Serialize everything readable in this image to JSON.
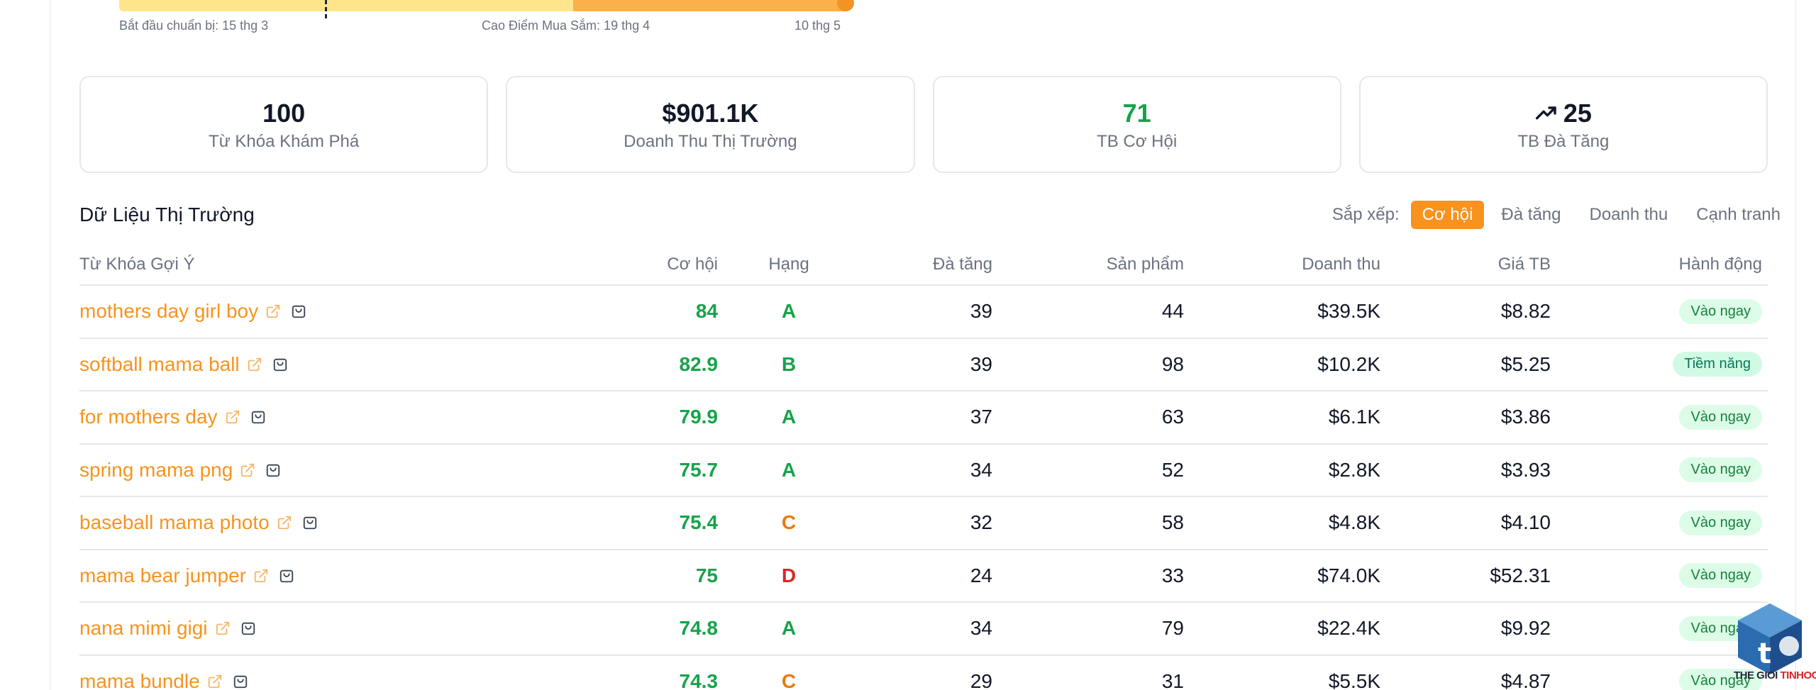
{
  "timeline": {
    "prep_label": "Bắt đầu chuẩn bị: 15 thg 3",
    "peak_label": "Cao Điểm Mua Sắm: 19 thg 4",
    "end_label": "10 thg 5"
  },
  "stats": [
    {
      "value": "100",
      "label": "Từ Khóa Khám Phá"
    },
    {
      "value": "$901.1K",
      "label": "Doanh Thu Thị Trường"
    },
    {
      "value": "71",
      "label": "TB Cơ Hội"
    },
    {
      "value": "25",
      "label": "TB Đà Tăng",
      "icon": "trending-up-icon"
    }
  ],
  "section": {
    "title": "Dữ Liệu Thị Trường"
  },
  "sort": {
    "label": "Sắp xếp:",
    "options": [
      "Cơ hội",
      "Đà tăng",
      "Doanh thu",
      "Cạnh tranh"
    ],
    "active": "Cơ hội"
  },
  "table": {
    "headers": {
      "keyword": "Từ Khóa Gợi Ý",
      "opportunity": "Cơ hội",
      "rank": "Hạng",
      "momentum": "Đà tăng",
      "products": "Sản phẩm",
      "revenue": "Doanh thu",
      "avg_price": "Giá TB",
      "action": "Hành động"
    },
    "rows": [
      {
        "keyword": "mothers day girl boy",
        "opportunity": "84",
        "rank": "A",
        "momentum": "39",
        "products": "44",
        "revenue": "$39.5K",
        "avg_price": "$8.82",
        "action": "Vào ngay"
      },
      {
        "keyword": "softball mama ball",
        "opportunity": "82.9",
        "rank": "B",
        "momentum": "39",
        "products": "98",
        "revenue": "$10.2K",
        "avg_price": "$5.25",
        "action": "Tiềm năng"
      },
      {
        "keyword": "for mothers day",
        "opportunity": "79.9",
        "rank": "A",
        "momentum": "37",
        "products": "63",
        "revenue": "$6.1K",
        "avg_price": "$3.86",
        "action": "Vào ngay"
      },
      {
        "keyword": "spring mama png",
        "opportunity": "75.7",
        "rank": "A",
        "momentum": "34",
        "products": "52",
        "revenue": "$2.8K",
        "avg_price": "$3.93",
        "action": "Vào ngay"
      },
      {
        "keyword": "baseball mama photo",
        "opportunity": "75.4",
        "rank": "C",
        "momentum": "32",
        "products": "58",
        "revenue": "$4.8K",
        "avg_price": "$4.10",
        "action": "Vào ngay"
      },
      {
        "keyword": "mama bear jumper",
        "opportunity": "75",
        "rank": "D",
        "momentum": "24",
        "products": "33",
        "revenue": "$74.0K",
        "avg_price": "$52.31",
        "action": "Vào ngay"
      },
      {
        "keyword": "nana mimi gigi",
        "opportunity": "74.8",
        "rank": "A",
        "momentum": "34",
        "products": "79",
        "revenue": "$22.4K",
        "avg_price": "$9.92",
        "action": "Vào ngay"
      },
      {
        "keyword": "mama bundle",
        "opportunity": "74.3",
        "rank": "C",
        "momentum": "29",
        "products": "31",
        "revenue": "$5.5K",
        "avg_price": "$4.87",
        "action": "Vào ngay"
      }
    ]
  },
  "watermark": {
    "brand_main": "THE GIOI ",
    "brand_accent": "TINHOC"
  },
  "colors": {
    "accent": "#f7931e",
    "green": "#16a34a",
    "rank_c": "#ea7a0c",
    "rank_d": "#dc2626",
    "badge_bg": "#dcfce7"
  }
}
